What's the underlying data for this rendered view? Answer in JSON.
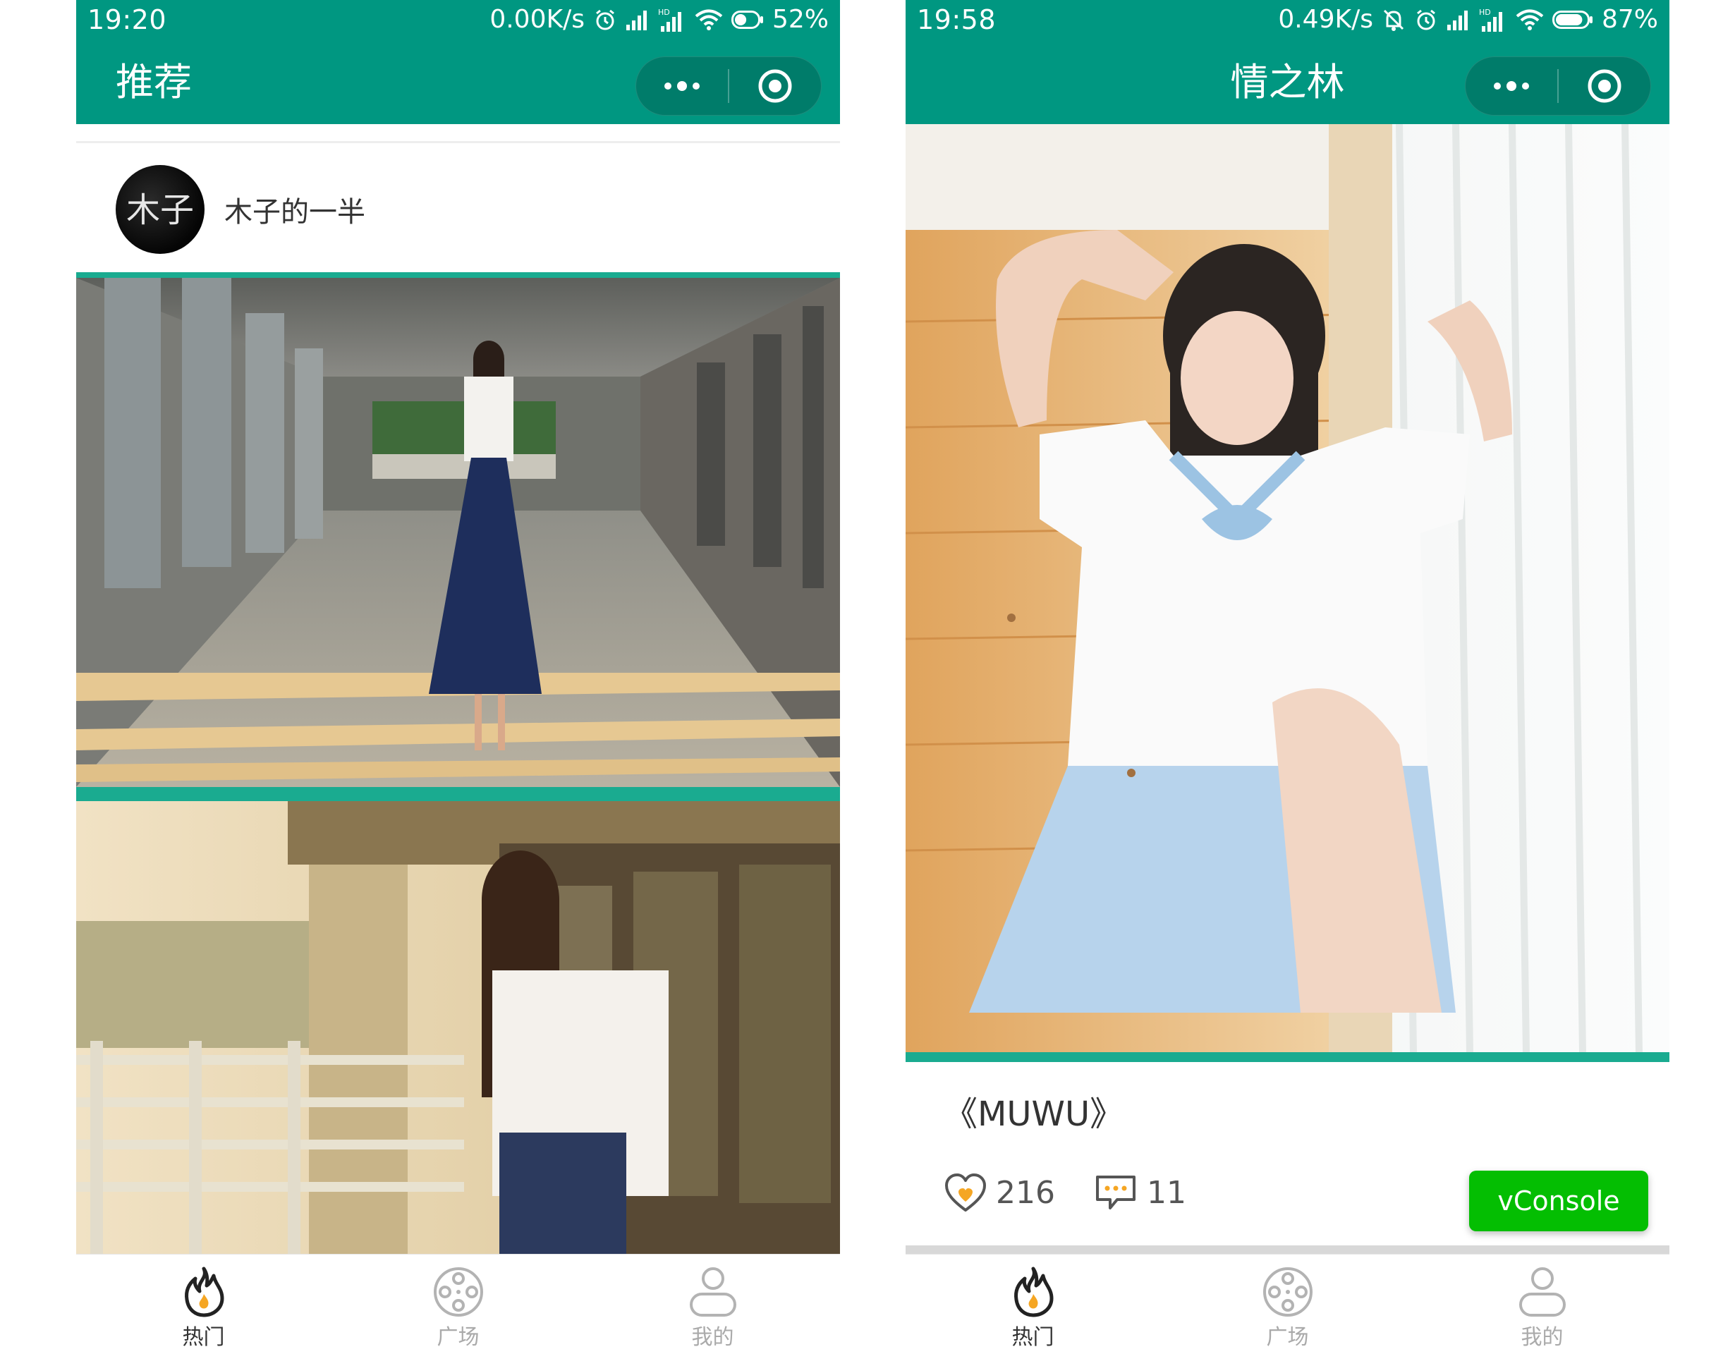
{
  "left_phone": {
    "status": {
      "time": "19:20",
      "speed": "0.00K/s",
      "hd": "HD",
      "battery": "52%",
      "battery_level": 0.52
    },
    "nav": {
      "title": "推荐"
    },
    "author": {
      "name": "木子的一半",
      "avatar_text": "木子"
    }
  },
  "right_phone": {
    "status": {
      "time": "19:58",
      "speed": "0.49K/s",
      "hd": "HD",
      "battery": "87%",
      "battery_level": 0.87
    },
    "nav": {
      "title": "情之林"
    },
    "card": {
      "title": "《MUWU》",
      "likes": "216",
      "comments": "11"
    },
    "vconsole_label": "vConsole"
  },
  "tabbar": {
    "items": [
      {
        "label": "热门",
        "icon": "flame-icon",
        "active": true
      },
      {
        "label": "广场",
        "icon": "film-reel-icon",
        "active": false
      },
      {
        "label": "我的",
        "icon": "person-icon",
        "active": false
      }
    ]
  },
  "colors": {
    "header": "#009781",
    "accent_bar": "#1aab90",
    "vconsole": "#04be02",
    "flame": "#f5a623"
  }
}
